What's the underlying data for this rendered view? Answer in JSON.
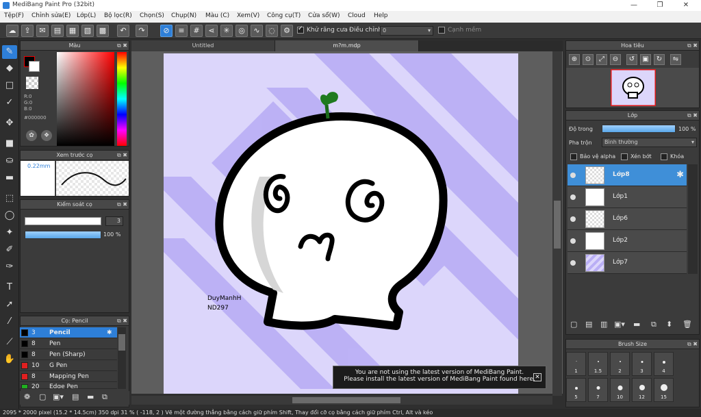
{
  "window": {
    "title": "MediBang Paint Pro (32bit)",
    "minimize": "—",
    "maximize": "❐",
    "close": "✕"
  },
  "menu": [
    "Tệp(F)",
    "Chỉnh sửa(E)",
    "Lớp(L)",
    "Bộ lọc(R)",
    "Chọn(S)",
    "Chụp(N)",
    "Màu (C)",
    "Xem(V)",
    "Công cụ(T)",
    "Cửa sổ(W)",
    "Cloud",
    "Help"
  ],
  "toolbar": {
    "antialias_label": "Khử răng cưa",
    "adjust_label": "Điều chỉnh",
    "adjust_value": "0",
    "smooth_label": "Cạnh mềm"
  },
  "color_panel": {
    "title": "Màu",
    "r": "R:0",
    "g": "G:0",
    "b": "B:0",
    "hex": "#000000"
  },
  "preview_panel": {
    "title": "Xem trước cọ",
    "size": "0.22mm"
  },
  "brush_control": {
    "title": "Kiểm soát cọ",
    "size": "3",
    "opacity": "100 %"
  },
  "brush_panel": {
    "title": "Cọ: Pencil",
    "items": [
      {
        "size": "3",
        "name": "Pencil",
        "color": "#000000"
      },
      {
        "size": "8",
        "name": "Pen",
        "color": "#000000"
      },
      {
        "size": "8",
        "name": "Pen (Sharp)",
        "color": "#000000"
      },
      {
        "size": "10",
        "name": "G Pen",
        "color": "#e02020"
      },
      {
        "size": "8",
        "name": "Mapping Pen",
        "color": "#e02020"
      },
      {
        "size": "20",
        "name": "Edge Pen",
        "color": "#20b020"
      }
    ]
  },
  "tabs": [
    "Untitled",
    "m?m.mdp"
  ],
  "artwork": {
    "signature_line1": "DuyManhH",
    "signature_line2": "ND297"
  },
  "notice": {
    "line1": "You are not using the latest version of MediBang Paint.",
    "line2": "Please install the latest version of MediBang Paint found here."
  },
  "navigator": {
    "title": "Hoa tiêu"
  },
  "layer_panel": {
    "title": "Lớp",
    "opacity_label": "Độ trong",
    "opacity_value": "100 %",
    "blend_label": "Pha trộn",
    "blend_value": "Bình thường",
    "protect_alpha": "Bảo vệ alpha",
    "clipping": "Xén bớt",
    "lock": "Khóa",
    "layers": [
      "Lớp8",
      "Lớp1",
      "Lớp6",
      "Lớp2",
      "Lớp7"
    ]
  },
  "brush_size": {
    "title": "Brush Size",
    "sizes": [
      "1",
      "1.5",
      "2",
      "3",
      "4",
      "5",
      "7",
      "10",
      "12",
      "15"
    ]
  },
  "status": {
    "text": "2095 * 2000 pixel   (15.2 * 14.5cm)   350 dpi   31 %   ( -118, 2 )   Vẽ một đường thẳng bằng cách giữ phím Shift, Thay đổi cỡ cọ bằng cách giữ phím Ctrl, Alt và kéo"
  },
  "colors": {
    "accent": "#2e7fd8",
    "canvas_bg": "#dcd6fb",
    "stripe": "#b9aef5"
  }
}
